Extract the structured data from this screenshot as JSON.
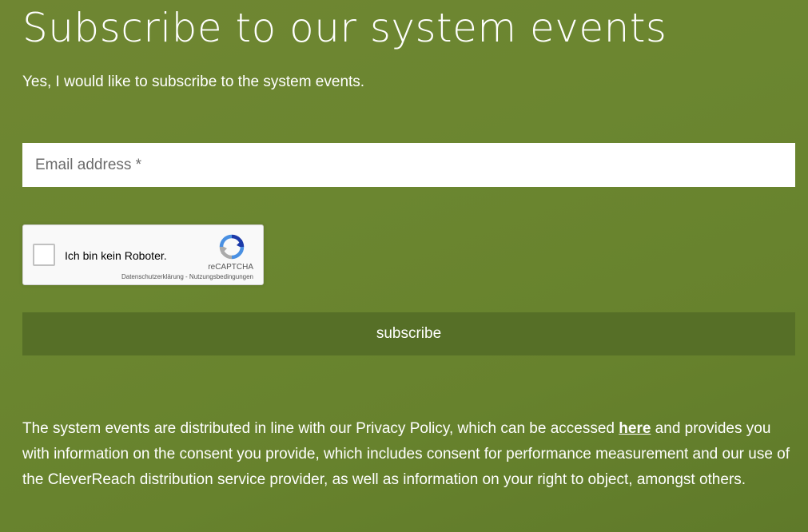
{
  "page": {
    "title": "Subscribe to our system events",
    "lead": "Yes, I would like to subscribe to the system events."
  },
  "form": {
    "email_placeholder": "Email address *",
    "email_value": "",
    "submit_label": "subscribe"
  },
  "recaptcha": {
    "label": "Ich bin kein Roboter.",
    "brand": "reCAPTCHA",
    "privacy_link": "Datenschutzerklärung",
    "separator": " - ",
    "terms_link": "Nutzungsbedingungen",
    "checked": false
  },
  "legal": {
    "text_before": "The system events are distributed in line with our Privacy Policy, which can be accessed ",
    "link_text": "here",
    "text_after": " and provides you with information on the consent you provide, which includes consent for performance measurement and our use of the CleverReach distribution service provider, as well as information on your right to object, amongst others."
  },
  "colors": {
    "background": "#6b8630",
    "button": "#566f27",
    "text": "#ffffff"
  }
}
